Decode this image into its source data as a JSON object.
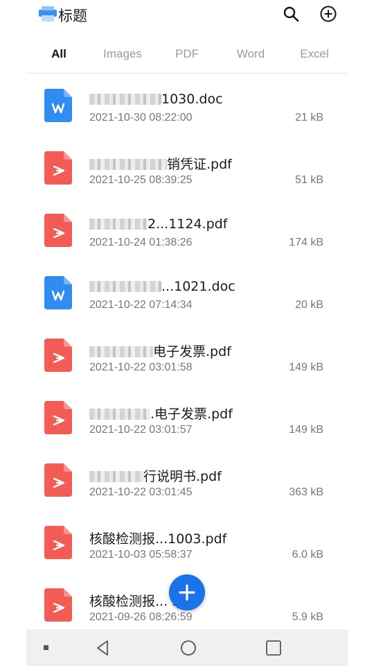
{
  "header": {
    "title": "标题",
    "icons": [
      "app-logo-icon",
      "search-icon",
      "add-circle-icon"
    ]
  },
  "tabs": [
    "All",
    "Images",
    "PDF",
    "Word",
    "Excel"
  ],
  "active_tab": "All",
  "files": [
    {
      "type": "word",
      "name_blur": true,
      "name": "1030.doc",
      "date": "2021-10-30 08:22:00",
      "size": "21 kB"
    },
    {
      "type": "pdf",
      "name_blur": true,
      "name": "销凭证.pdf",
      "date": "2021-10-25 08:39:25",
      "size": "51 kB"
    },
    {
      "type": "pdf",
      "name_blur": true,
      "name": "2...1124.pdf",
      "date": "2021-10-24 01:38:26",
      "size": "174 kB"
    },
    {
      "type": "word",
      "name_blur": true,
      "name": "...1021.doc",
      "date": "2021-10-22 07:14:34",
      "size": "20 kB"
    },
    {
      "type": "pdf",
      "name_blur": true,
      "name": "电子发票.pdf",
      "date": "2021-10-22 03:01:58",
      "size": "149 kB"
    },
    {
      "type": "pdf",
      "name_blur": true,
      "name": ".电子发票.pdf",
      "date": "2021-10-22 03:01:57",
      "size": "149 kB"
    },
    {
      "type": "pdf",
      "name_blur": true,
      "name": "行说明书.pdf",
      "date": "2021-10-22 03:01:45",
      "size": "363 kB"
    },
    {
      "type": "pdf",
      "name_blur": false,
      "name": "核酸检测报...1003.pdf",
      "date": "2021-10-03 05:58:37",
      "size": "6.0 kB"
    },
    {
      "type": "pdf",
      "name_blur": false,
      "name": "核酸检测报...   .pdf",
      "date": "2021-09-26 08:26:59",
      "size": "5.9 kB"
    }
  ],
  "colors": {
    "word": "#2f8cf0",
    "pdf": "#f25c54",
    "fab": "#1a73e8"
  }
}
